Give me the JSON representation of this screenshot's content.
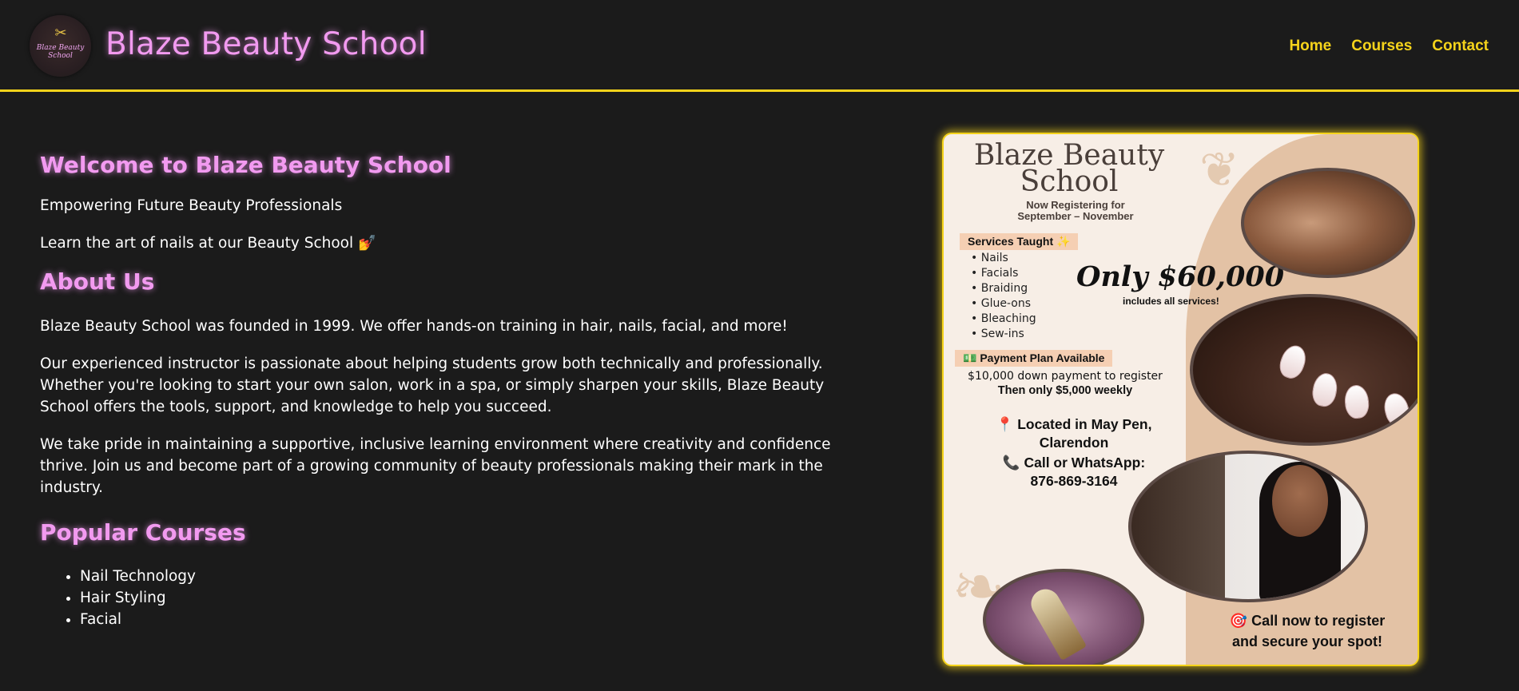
{
  "header": {
    "logo_text": "Blaze Beauty School",
    "title": "Blaze Beauty School",
    "nav": [
      {
        "label": "Home"
      },
      {
        "label": "Courses"
      },
      {
        "label": "Contact"
      }
    ]
  },
  "main": {
    "welcome_heading": "Welcome to Blaze Beauty School",
    "tagline": "Empowering Future Beauty Professionals",
    "subtagline": "Learn the art of nails at our Beauty School 💅",
    "about_heading": "About Us",
    "about_paragraphs": [
      "Blaze Beauty School was founded in 1999. We offer hands-on training in hair, nails, facial, and more!",
      "Our experienced instructor is passionate about helping students grow both technically and professionally. Whether you're looking to start your own salon, work in a spa, or simply sharpen your skills, Blaze Beauty School offers the tools, support, and knowledge to help you succeed.",
      "We take pride in maintaining a supportive, inclusive learning environment where creativity and confidence thrive. Join us and become part of a growing community of beauty professionals making their mark in the industry."
    ],
    "courses_heading": "Popular Courses",
    "courses": [
      "Nail Technology",
      "Hair Styling",
      "Facial"
    ]
  },
  "flyer": {
    "title_line1": "Blaze Beauty",
    "title_line2": "School",
    "registering_line1": "Now Registering for",
    "registering_line2": "September – November",
    "services_label": "Services Taught ✨",
    "services": [
      "Nails",
      "Facials",
      "Braiding",
      "Glue-ons",
      "Bleaching",
      "Sew-ins"
    ],
    "price": "Only $60,000",
    "price_sub": "includes all services!",
    "payment_label": "💵 Payment Plan Available",
    "payment_line1": "$10,000 down payment to register",
    "payment_line2": "Then only $5,000 weekly",
    "location_line1": "📍 Located in May Pen,",
    "location_line2": "Clarendon",
    "call_line1": "📞 Call or WhatsApp:",
    "call_line2": "876-869-3164",
    "cta_line1": "🎯 Call now to register",
    "cta_line2": "and secure your spot!"
  },
  "colors": {
    "background": "#1b1b1b",
    "accent_pink": "#f29af0",
    "accent_yellow": "#f5d31b"
  }
}
